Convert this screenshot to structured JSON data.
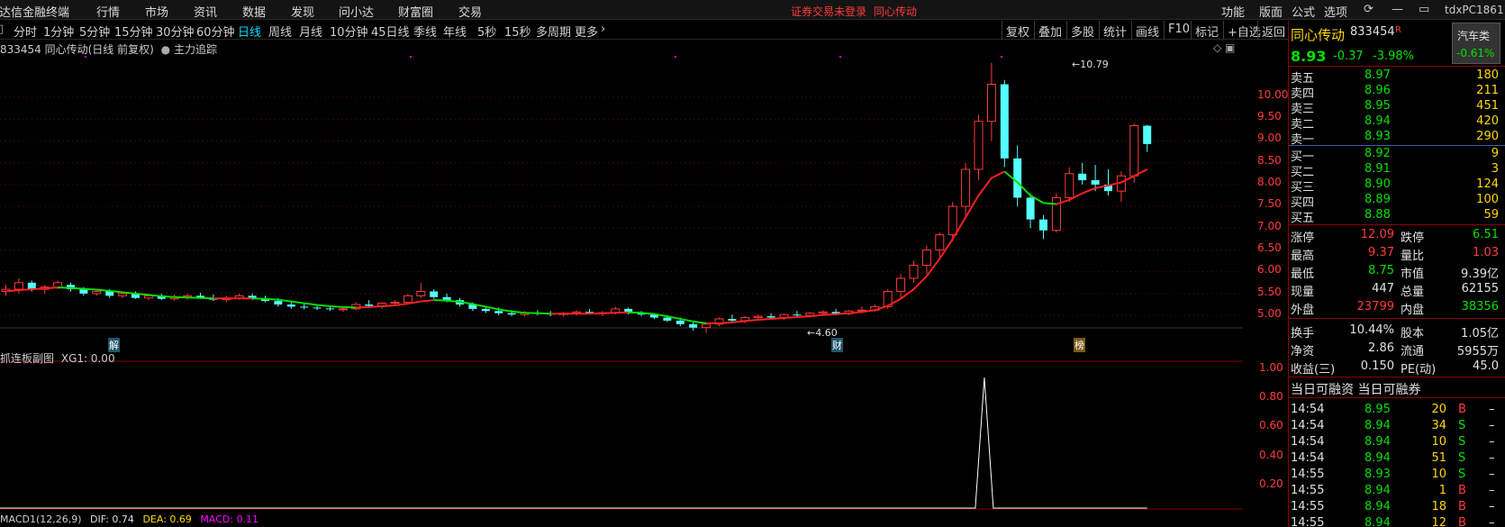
{
  "titlebar": {
    "app_name": "通达信金融终端",
    "menu": [
      "行情",
      "市场",
      "资讯",
      "数据",
      "发现",
      "问小达",
      "财富圈",
      "交易"
    ],
    "warning": "证券交易未登录",
    "stock_name": "同心传动",
    "right_menu": [
      "功能",
      "版面",
      "公式",
      "选项"
    ],
    "user": "tdxPC18611"
  },
  "periods": [
    "分时",
    "1分钟",
    "5分钟",
    "15分钟",
    "30分钟",
    "60分钟",
    "日线",
    "周线",
    "月线",
    "10分钟",
    "45日线",
    "季线",
    "年线",
    "5秒",
    "15秒",
    "多周期",
    "更多"
  ],
  "active_period": "日线",
  "toolbar": [
    "复权",
    "叠加",
    "多股",
    "统计",
    "画线",
    "F10",
    "标记",
    "+自选",
    "返回"
  ],
  "main_chart": {
    "title": "833454 同心传动(日线 前复权)",
    "indicator": "主力追踪",
    "high_label": "10.79",
    "low_label": "4.60",
    "markers": [
      "解",
      "财",
      "榜"
    ],
    "y_ticks": [
      "10.00",
      "9.50",
      "9.00",
      "8.50",
      "8.00",
      "7.50",
      "7.00",
      "6.50",
      "6.00",
      "5.50",
      "5.00"
    ]
  },
  "sub_chart": {
    "title": "抓连板副图",
    "value_label": "XG1: 0.00",
    "y_ticks": [
      "1.00",
      "0.80",
      "0.60",
      "0.40",
      "0.20"
    ]
  },
  "macd": {
    "name": "MACD1(12,26,9)",
    "dif": "DIF: 0.74",
    "dea": "DEA: 0.69",
    "macd": "MACD: 0.11"
  },
  "chart_data": {
    "type": "candlestick",
    "title": "833454 同心传动(日线 前复权)",
    "ylim": [
      4.3,
      11.2
    ],
    "candles": [
      [
        5.55,
        5.7,
        5.45,
        5.6
      ],
      [
        5.6,
        5.85,
        5.5,
        5.75
      ],
      [
        5.75,
        5.8,
        5.55,
        5.6
      ],
      [
        5.6,
        5.7,
        5.5,
        5.65
      ],
      [
        5.65,
        5.8,
        5.6,
        5.75
      ],
      [
        5.7,
        5.75,
        5.55,
        5.6
      ],
      [
        5.6,
        5.65,
        5.45,
        5.5
      ],
      [
        5.5,
        5.6,
        5.45,
        5.55
      ],
      [
        5.55,
        5.6,
        5.4,
        5.45
      ],
      [
        5.45,
        5.55,
        5.4,
        5.5
      ],
      [
        5.5,
        5.55,
        5.38,
        5.4
      ],
      [
        5.4,
        5.5,
        5.35,
        5.45
      ],
      [
        5.45,
        5.5,
        5.35,
        5.38
      ],
      [
        5.38,
        5.48,
        5.33,
        5.42
      ],
      [
        5.42,
        5.5,
        5.36,
        5.45
      ],
      [
        5.45,
        5.52,
        5.38,
        5.4
      ],
      [
        5.4,
        5.48,
        5.33,
        5.36
      ],
      [
        5.36,
        5.45,
        5.3,
        5.4
      ],
      [
        5.4,
        5.5,
        5.36,
        5.45
      ],
      [
        5.45,
        5.5,
        5.35,
        5.38
      ],
      [
        5.38,
        5.45,
        5.3,
        5.33
      ],
      [
        5.33,
        5.4,
        5.2,
        5.25
      ],
      [
        5.25,
        5.32,
        5.15,
        5.2
      ],
      [
        5.2,
        5.28,
        5.14,
        5.18
      ],
      [
        5.18,
        5.25,
        5.12,
        5.16
      ],
      [
        5.16,
        5.22,
        5.1,
        5.14
      ],
      [
        5.14,
        5.2,
        5.08,
        5.15
      ],
      [
        5.15,
        5.3,
        5.12,
        5.25
      ],
      [
        5.25,
        5.35,
        5.18,
        5.22
      ],
      [
        5.22,
        5.3,
        5.15,
        5.28
      ],
      [
        5.28,
        5.35,
        5.22,
        5.3
      ],
      [
        5.3,
        5.5,
        5.25,
        5.45
      ],
      [
        5.45,
        5.75,
        5.4,
        5.55
      ],
      [
        5.55,
        5.6,
        5.38,
        5.42
      ],
      [
        5.42,
        5.5,
        5.3,
        5.35
      ],
      [
        5.35,
        5.4,
        5.2,
        5.25
      ],
      [
        5.25,
        5.3,
        5.1,
        5.15
      ],
      [
        5.15,
        5.22,
        5.05,
        5.1
      ],
      [
        5.1,
        5.18,
        5.0,
        5.05
      ],
      [
        5.05,
        5.12,
        4.98,
        5.02
      ],
      [
        5.02,
        5.1,
        4.98,
        5.06
      ],
      [
        5.06,
        5.12,
        5.0,
        5.04
      ],
      [
        5.04,
        5.1,
        4.98,
        5.02
      ],
      [
        5.02,
        5.08,
        4.97,
        5.05
      ],
      [
        5.05,
        5.12,
        5.0,
        5.08
      ],
      [
        5.08,
        5.15,
        5.02,
        5.04
      ],
      [
        5.04,
        5.1,
        4.98,
        5.06
      ],
      [
        5.06,
        5.2,
        5.02,
        5.15
      ],
      [
        5.15,
        5.18,
        5.02,
        5.05
      ],
      [
        5.05,
        5.1,
        4.98,
        5.02
      ],
      [
        5.02,
        5.05,
        4.92,
        4.95
      ],
      [
        4.95,
        5.0,
        4.85,
        4.88
      ],
      [
        4.88,
        4.95,
        4.75,
        4.8
      ],
      [
        4.8,
        4.85,
        4.65,
        4.72
      ],
      [
        4.72,
        4.85,
        4.6,
        4.8
      ],
      [
        4.8,
        4.95,
        4.75,
        4.92
      ],
      [
        4.92,
        5.02,
        4.85,
        4.88
      ],
      [
        4.88,
        4.98,
        4.82,
        4.95
      ],
      [
        4.95,
        5.02,
        4.9,
        4.98
      ],
      [
        4.98,
        5.05,
        4.92,
        4.95
      ],
      [
        4.95,
        5.05,
        4.9,
        5.02
      ],
      [
        5.02,
        5.1,
        4.96,
        5.0
      ],
      [
        5.0,
        5.08,
        4.95,
        5.05
      ],
      [
        5.05,
        5.12,
        5.0,
        5.08
      ],
      [
        5.08,
        5.15,
        5.0,
        5.04
      ],
      [
        5.04,
        5.12,
        5.0,
        5.1
      ],
      [
        5.1,
        5.2,
        5.05,
        5.12
      ],
      [
        5.12,
        5.25,
        5.08,
        5.2
      ],
      [
        5.2,
        5.6,
        5.15,
        5.55
      ],
      [
        5.55,
        5.95,
        5.4,
        5.85
      ],
      [
        5.85,
        6.25,
        5.75,
        6.15
      ],
      [
        6.15,
        6.6,
        5.95,
        6.5
      ],
      [
        6.5,
        6.9,
        6.3,
        6.85
      ],
      [
        6.85,
        7.6,
        6.7,
        7.5
      ],
      [
        7.5,
        8.5,
        7.3,
        8.35
      ],
      [
        8.35,
        9.6,
        8.1,
        9.45
      ],
      [
        9.45,
        10.79,
        9.0,
        10.3
      ],
      [
        10.3,
        10.4,
        8.4,
        8.6
      ],
      [
        8.6,
        8.9,
        7.5,
        7.7
      ],
      [
        7.7,
        7.8,
        7.0,
        7.2
      ],
      [
        7.2,
        7.3,
        6.75,
        6.95
      ],
      [
        6.95,
        7.8,
        6.9,
        7.7
      ],
      [
        7.7,
        8.4,
        7.6,
        8.25
      ],
      [
        8.25,
        8.5,
        8.0,
        8.1
      ],
      [
        8.1,
        8.45,
        7.85,
        8.0
      ],
      [
        8.0,
        8.35,
        7.75,
        7.85
      ],
      [
        7.85,
        8.3,
        7.6,
        8.2
      ],
      [
        8.2,
        9.4,
        8.05,
        9.35
      ],
      [
        9.35,
        9.37,
        8.75,
        8.93
      ]
    ],
    "ma_line": [
      5.55,
      5.58,
      5.6,
      5.62,
      5.64,
      5.63,
      5.61,
      5.59,
      5.56,
      5.53,
      5.5,
      5.47,
      5.44,
      5.42,
      5.41,
      5.4,
      5.39,
      5.39,
      5.39,
      5.39,
      5.38,
      5.36,
      5.32,
      5.28,
      5.24,
      5.21,
      5.19,
      5.18,
      5.19,
      5.21,
      5.23,
      5.27,
      5.32,
      5.35,
      5.34,
      5.31,
      5.26,
      5.2,
      5.14,
      5.09,
      5.06,
      5.05,
      5.04,
      5.04,
      5.04,
      5.04,
      5.05,
      5.06,
      5.07,
      5.06,
      5.03,
      4.98,
      4.92,
      4.86,
      4.82,
      4.82,
      4.84,
      4.87,
      4.9,
      4.92,
      4.94,
      4.96,
      4.98,
      5.01,
      5.03,
      5.05,
      5.08,
      5.12,
      5.22,
      5.38,
      5.6,
      5.9,
      6.3,
      6.75,
      7.25,
      7.75,
      8.15,
      8.3,
      8.05,
      7.75,
      7.58,
      7.55,
      7.65,
      7.8,
      7.92,
      7.98,
      8.05,
      8.2,
      8.35
    ],
    "sub_series": {
      "name": "XG1",
      "spike_index": 76,
      "value": 1.0
    }
  },
  "quote": {
    "name": "同心传动",
    "code": "833454",
    "r_mark": "R",
    "sector": "汽车类",
    "sector_change": "-0.61%",
    "price": "8.93",
    "change": "-0.37",
    "change_pct": "-3.98%",
    "asks": [
      {
        "label": "卖五",
        "price": "8.97",
        "vol": "180"
      },
      {
        "label": "卖四",
        "price": "8.96",
        "vol": "211"
      },
      {
        "label": "卖三",
        "price": "8.95",
        "vol": "451"
      },
      {
        "label": "卖二",
        "price": "8.94",
        "vol": "420"
      },
      {
        "label": "卖一",
        "price": "8.93",
        "vol": "290"
      }
    ],
    "bids": [
      {
        "label": "买一",
        "price": "8.92",
        "vol": "9"
      },
      {
        "label": "买二",
        "price": "8.91",
        "vol": "3"
      },
      {
        "label": "买三",
        "price": "8.90",
        "vol": "124"
      },
      {
        "label": "买四",
        "price": "8.89",
        "vol": "100"
      },
      {
        "label": "买五",
        "price": "8.88",
        "vol": "59"
      }
    ],
    "stats": [
      {
        "l1": "涨停",
        "v1": "12.09",
        "c1": "red",
        "l2": "跌停",
        "v2": "6.51",
        "c2": "green"
      },
      {
        "l1": "最高",
        "v1": "9.37",
        "c1": "red",
        "l2": "量比",
        "v2": "1.03",
        "c2": "red"
      },
      {
        "l1": "最低",
        "v1": "8.75",
        "c1": "green",
        "l2": "市值",
        "v2": "9.39亿",
        "c2": "white"
      },
      {
        "l1": "现量",
        "v1": "447",
        "c1": "white",
        "l2": "总量",
        "v2": "62155",
        "c2": "white"
      },
      {
        "l1": "外盘",
        "v1": "23799",
        "c1": "red",
        "l2": "内盘",
        "v2": "38356",
        "c2": "green"
      }
    ],
    "stats2": [
      {
        "l1": "换手",
        "v1": "10.44%",
        "l2": "股本",
        "v2": "1.05亿"
      },
      {
        "l1": "净资",
        "v1": "2.86",
        "l2": "流通",
        "v2": "5955万"
      },
      {
        "l1": "收益(三)",
        "v1": "0.150",
        "l2": "PE(动)",
        "v2": "45.0"
      }
    ],
    "margin_label": "当日可融资 当日可融券",
    "ticks": [
      {
        "time": "14:54",
        "price": "8.95",
        "vol": "20",
        "side": "B"
      },
      {
        "time": "14:54",
        "price": "8.94",
        "vol": "34",
        "side": "S"
      },
      {
        "time": "14:54",
        "price": "8.94",
        "vol": "10",
        "side": "S"
      },
      {
        "time": "14:54",
        "price": "8.94",
        "vol": "51",
        "side": "S"
      },
      {
        "time": "14:55",
        "price": "8.93",
        "vol": "10",
        "side": "S"
      },
      {
        "time": "14:55",
        "price": "8.94",
        "vol": "1",
        "side": "B"
      },
      {
        "time": "14:55",
        "price": "8.94",
        "vol": "18",
        "side": "B"
      },
      {
        "time": "14:55",
        "price": "8.94",
        "vol": "12",
        "side": "B"
      }
    ]
  }
}
